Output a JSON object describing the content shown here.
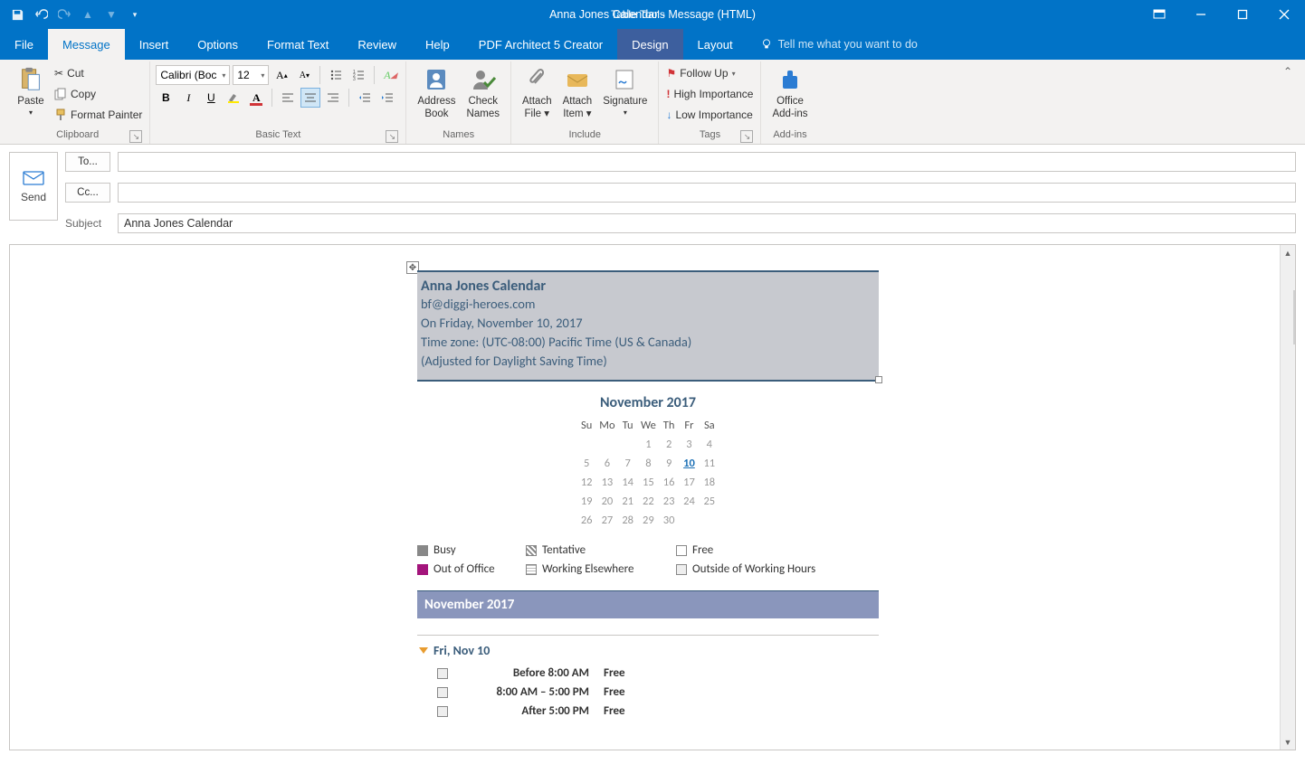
{
  "window": {
    "title": "Anna Jones Calendar  -  Message (HTML)",
    "tools_label": "Table Tools"
  },
  "tabs": {
    "file": "File",
    "message": "Message",
    "insert": "Insert",
    "options": "Options",
    "format": "Format Text",
    "review": "Review",
    "help": "Help",
    "pdf": "PDF Architect 5 Creator",
    "design": "Design",
    "layout": "Layout",
    "tellme": "Tell me what you want to do"
  },
  "ribbon": {
    "clipboard": {
      "label": "Clipboard",
      "paste": "Paste",
      "cut": "Cut",
      "copy": "Copy",
      "painter": "Format Painter"
    },
    "basic": {
      "label": "Basic Text",
      "font": "Calibri (Boc",
      "size": "12"
    },
    "names": {
      "label": "Names",
      "addr1": "Address",
      "addr2": "Book",
      "chk1": "Check",
      "chk2": "Names"
    },
    "include": {
      "label": "Include",
      "af1": "Attach",
      "af2": "File",
      "ai1": "Attach",
      "ai2": "Item",
      "sig": "Signature"
    },
    "tags": {
      "label": "Tags",
      "follow": "Follow Up",
      "high": "High Importance",
      "low": "Low Importance"
    },
    "addins": {
      "label": "Add-ins",
      "office1": "Office",
      "office2": "Add-ins"
    }
  },
  "compose": {
    "send": "Send",
    "to": "To...",
    "cc": "Cc...",
    "subject_label": "Subject",
    "subject_value": "Anna Jones Calendar"
  },
  "calendar": {
    "title": "Anna Jones Calendar",
    "email": "bf@diggi-heroes.com",
    "dateline": "On Friday, November 10, 2017",
    "tzline": "Time zone: (UTC-08:00) Pacific Time (US & Canada)",
    "dst": "(Adjusted for Daylight Saving Time)",
    "month": "November 2017",
    "dow": [
      "Su",
      "Mo",
      "Tu",
      "We",
      "Th",
      "Fr",
      "Sa"
    ],
    "weeks": [
      [
        "",
        "",
        "",
        "1",
        "2",
        "3",
        "4"
      ],
      [
        "5",
        "6",
        "7",
        "8",
        "9",
        "10",
        "11"
      ],
      [
        "12",
        "13",
        "14",
        "15",
        "16",
        "17",
        "18"
      ],
      [
        "19",
        "20",
        "21",
        "22",
        "23",
        "24",
        "25"
      ],
      [
        "26",
        "27",
        "28",
        "29",
        "30",
        "",
        ""
      ]
    ],
    "selected": "10",
    "legend": {
      "busy": "Busy",
      "tent": "Tentative",
      "free": "Free",
      "ooo": "Out of Office",
      "we": "Working Elsewhere",
      "owh": "Outside of Working Hours"
    },
    "monthbar": "November 2017",
    "dayhead": "Fri, Nov 10",
    "slots": [
      {
        "time": "Before 8:00 AM",
        "status": "Free"
      },
      {
        "time": "8:00 AM – 5:00 PM",
        "status": "Free"
      },
      {
        "time": "After 5:00 PM",
        "status": "Free"
      }
    ]
  }
}
